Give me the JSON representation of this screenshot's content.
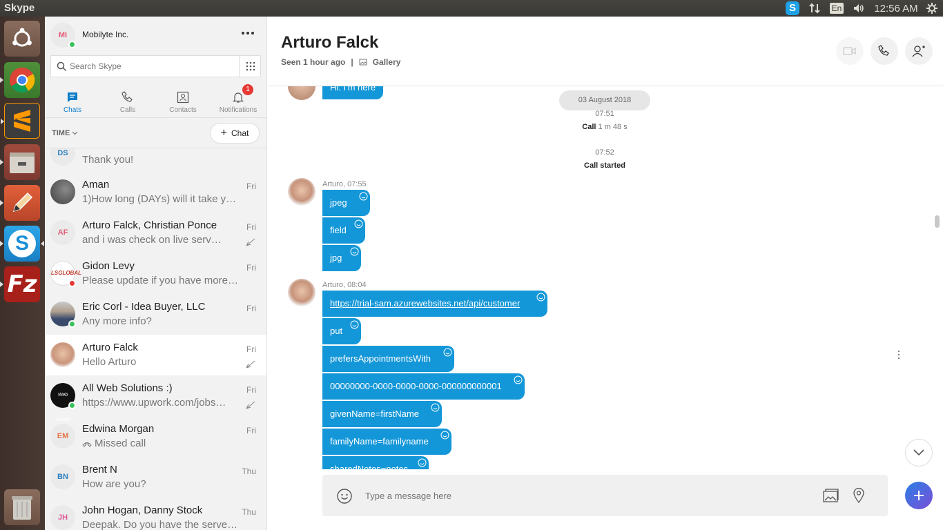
{
  "topbar": {
    "app_title": "Skype",
    "lang": "En",
    "time": "12:56 AM"
  },
  "launcher": {
    "items": [
      "ubuntu-dash-icon",
      "chrome-icon",
      "sublime-text-icon",
      "file-manager-icon",
      "pencil-tool-icon",
      "skype-icon",
      "filezilla-icon",
      "trash-icon"
    ]
  },
  "sidebar": {
    "profile_initials": "MI",
    "profile_name": "Mobilyte Inc.",
    "search_placeholder": "Search Skype",
    "tabs": [
      {
        "label": "Chats"
      },
      {
        "label": "Calls"
      },
      {
        "label": "Contacts"
      },
      {
        "label": "Notifications",
        "badge": "1"
      }
    ],
    "sort_label": "TIME",
    "new_chat_label": "Chat",
    "partial_row": {
      "initials": "DS",
      "preview": "Thank you!"
    },
    "chats": [
      {
        "name": "Aman",
        "preview": "1)How long (DAYs) will it take you t...",
        "date": "Fri"
      },
      {
        "name": "Arturo Falck, Christian Ponce",
        "initials": "AF",
        "preview": "and i was check on live server hav...",
        "date": "Fri"
      },
      {
        "name": "Gidon Levy",
        "preview": "Please update if you have more w...",
        "date": "Fri"
      },
      {
        "name": "Eric Corl - Idea Buyer, LLC",
        "preview": "Any more info?",
        "date": "Fri"
      },
      {
        "name": "Arturo Falck",
        "preview": "Hello Arturo",
        "date": "Fri"
      },
      {
        "name": "All Web Solutions :)",
        "preview": "https://www.upwork.com/jobs/_~...",
        "date": "Fri"
      },
      {
        "name": "Edwina Morgan",
        "initials": "EM",
        "preview": "Missed call",
        "date": "Fri"
      },
      {
        "name": "Brent N",
        "initials": "BN",
        "preview": "How are you?",
        "date": "Thu"
      },
      {
        "name": "John Hogan, Danny Stock",
        "initials": "JH",
        "preview": "Deepak.  Do you have the server ...",
        "date": "Thu"
      }
    ]
  },
  "conversation": {
    "title": "Arturo Falck",
    "seen": "Seen 1 hour ago",
    "separator": "|",
    "gallery_label": "Gallery",
    "partial_message": "Hi. I'm here",
    "date_pill": "03 August 2018",
    "events": [
      {
        "time": "07:51",
        "label": "Call",
        "detail": "1 m 48 s"
      },
      {
        "time": "07:52",
        "label": "Call started"
      }
    ],
    "group1": {
      "sender": "Arturo, 07:55",
      "messages": [
        "jpeg",
        "field",
        "jpg"
      ]
    },
    "group2": {
      "sender": "Arturo, 08:04",
      "messages": [
        "https://trial-sam.azurewebsites.net/api/customer",
        "put",
        "prefersAppointmentsWith",
        "00000000-0000-0000-0000-000000000001",
        "givenName=firstName",
        "familyName=familyname",
        "sharedNotes=notes"
      ]
    },
    "composer_placeholder": "Type a message here"
  }
}
